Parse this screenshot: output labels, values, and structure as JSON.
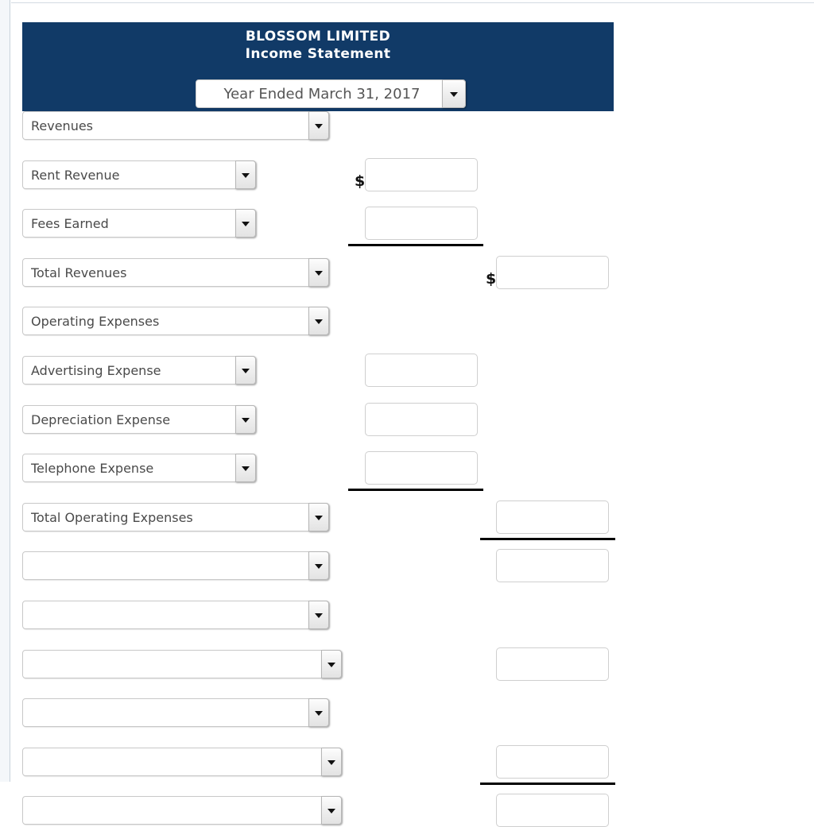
{
  "statement": {
    "company": "BLOSSOM LIMITED",
    "title": "Income Statement",
    "period": "Year Ended March 31, 2017",
    "header_bg": "#113a67",
    "currency_symbol": "$"
  },
  "rows": [
    {
      "id": "row-1",
      "label": "Revenues",
      "select_width": 386,
      "col1": null,
      "col2": null,
      "dollar": null,
      "rule": null
    },
    {
      "id": "row-2",
      "label": "Rent Revenue",
      "select_width": 294,
      "col1": "",
      "col2": null,
      "dollar": "col1",
      "rule": null
    },
    {
      "id": "row-3",
      "label": "Fees Earned",
      "select_width": 294,
      "col1": "",
      "col2": null,
      "dollar": null,
      "rule": "col1"
    },
    {
      "id": "row-4",
      "label": "Total Revenues",
      "select_width": 386,
      "col1": null,
      "col2": "",
      "dollar": "col2",
      "rule": null
    },
    {
      "id": "row-5",
      "label": "Operating Expenses",
      "select_width": 386,
      "col1": null,
      "col2": null,
      "dollar": null,
      "rule": null
    },
    {
      "id": "row-6",
      "label": "Advertising Expense",
      "select_width": 294,
      "col1": "",
      "col2": null,
      "dollar": null,
      "rule": null
    },
    {
      "id": "row-7",
      "label": "Depreciation Expense",
      "select_width": 294,
      "col1": "",
      "col2": null,
      "dollar": null,
      "rule": null
    },
    {
      "id": "row-8",
      "label": "Telephone Expense",
      "select_width": 294,
      "col1": "",
      "col2": null,
      "dollar": null,
      "rule": "col1"
    },
    {
      "id": "row-9",
      "label": "Total Operating Expenses",
      "select_width": 386,
      "col1": null,
      "col2": "",
      "dollar": null,
      "rule": "col2"
    },
    {
      "id": "row-10",
      "label": "",
      "select_width": 386,
      "col1": null,
      "col2": "",
      "dollar": null,
      "rule": null
    },
    {
      "id": "row-11",
      "label": "",
      "select_width": 386,
      "col1": null,
      "col2": null,
      "dollar": null,
      "rule": null
    },
    {
      "id": "row-12",
      "label": "",
      "select_width": 402,
      "col1": null,
      "col2": "",
      "dollar": null,
      "rule": null
    },
    {
      "id": "row-13",
      "label": "",
      "select_width": 386,
      "col1": null,
      "col2": null,
      "dollar": null,
      "rule": null
    },
    {
      "id": "row-14",
      "label": "",
      "select_width": 402,
      "col1": null,
      "col2": "",
      "dollar": null,
      "rule": "col2"
    },
    {
      "id": "row-15",
      "label": "",
      "select_width": 402,
      "col1": null,
      "col2": "",
      "dollar": null,
      "rule": null
    }
  ],
  "icons": {
    "dropdown": "chevron-down-icon"
  }
}
